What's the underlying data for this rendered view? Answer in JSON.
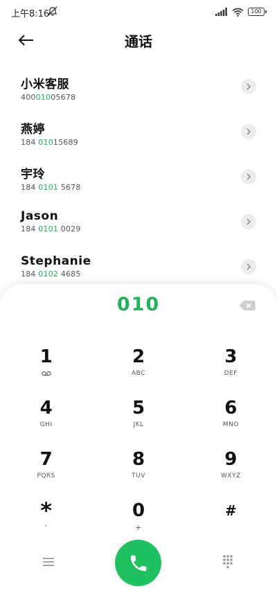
{
  "status_bar": {
    "time": "上午8:16",
    "battery": "100"
  },
  "header": {
    "title": "通话"
  },
  "contacts": [
    {
      "name": "小米客服",
      "number_parts": [
        "400",
        "010",
        "05678"
      ]
    },
    {
      "name": "燕婷",
      "number_parts": [
        "184 ",
        "010",
        "15689"
      ]
    },
    {
      "name": "宇玲",
      "number_parts": [
        "184 ",
        "0101",
        " 5678"
      ]
    },
    {
      "name": "Jason",
      "number_parts": [
        "184 ",
        "0101",
        " 0029"
      ]
    },
    {
      "name": "Stephanie",
      "number_parts": [
        "184 ",
        "0102",
        " 4685"
      ]
    }
  ],
  "dialer": {
    "input": "010",
    "keys": [
      [
        {
          "digit": "1",
          "sub": ""
        },
        {
          "digit": "2",
          "sub": "ABC"
        },
        {
          "digit": "3",
          "sub": "DEF"
        }
      ],
      [
        {
          "digit": "4",
          "sub": "GHI"
        },
        {
          "digit": "5",
          "sub": "JKL"
        },
        {
          "digit": "6",
          "sub": "MNO"
        }
      ],
      [
        {
          "digit": "7",
          "sub": "PQRS"
        },
        {
          "digit": "8",
          "sub": "TUV"
        },
        {
          "digit": "9",
          "sub": "WXYZ"
        }
      ],
      [
        {
          "digit": "*",
          "sub": ","
        },
        {
          "digit": "0",
          "sub": "+"
        },
        {
          "digit": "#",
          "sub": ""
        }
      ]
    ]
  },
  "colors": {
    "accent": "#1fb35a",
    "call_button": "#1fc05f"
  },
  "icons": {
    "back": "arrow-left-icon",
    "detail": "chevron-right-icon",
    "backspace": "backspace-icon",
    "voicemail": "voicemail-icon",
    "menu": "menu-icon",
    "call": "phone-icon",
    "keypad": "dialpad-icon"
  }
}
